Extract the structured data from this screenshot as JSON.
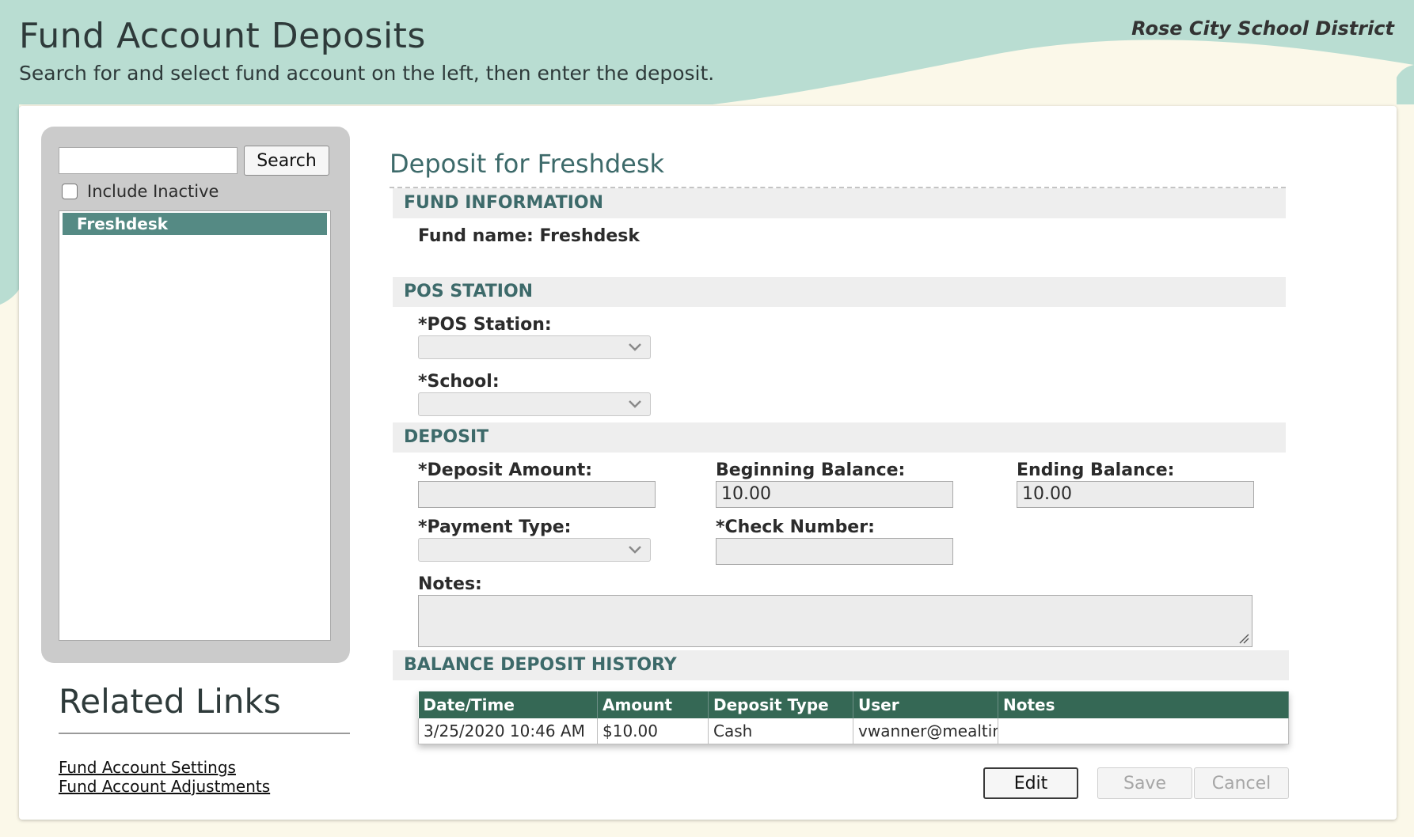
{
  "header": {
    "title": "Fund Account Deposits",
    "subtitle": "Search for and select fund account on the left, then enter the deposit.",
    "district": "Rose City School District"
  },
  "search": {
    "value": "",
    "button_label": "Search",
    "include_inactive_label": "Include Inactive",
    "include_inactive_checked": false,
    "results": [
      "Freshdesk"
    ],
    "selected": "Freshdesk"
  },
  "related_links": {
    "title": "Related Links",
    "links": [
      "Fund Account Settings",
      "Fund Account Adjustments"
    ]
  },
  "deposit": {
    "title": "Deposit for Freshdesk",
    "fund_info_header": "FUND INFORMATION",
    "fund_name_line": "Fund name: Freshdesk",
    "pos_header": "POS STATION",
    "pos_station_label": "*POS Station:",
    "pos_station_value": "",
    "school_label": "*School:",
    "school_value": "",
    "deposit_header": "DEPOSIT",
    "deposit_amount_label": "*Deposit Amount:",
    "deposit_amount_value": "",
    "beginning_balance_label": "Beginning Balance:",
    "beginning_balance_value": "10.00",
    "ending_balance_label": "Ending Balance:",
    "ending_balance_value": "10.00",
    "payment_type_label": "*Payment Type:",
    "payment_type_value": "",
    "check_number_label": "*Check Number:",
    "check_number_value": "",
    "notes_label": "Notes:",
    "notes_value": ""
  },
  "history": {
    "header": "BALANCE DEPOSIT HISTORY",
    "columns": [
      "Date/Time",
      "Amount",
      "Deposit Type",
      "User",
      "Notes"
    ],
    "rows": [
      [
        "3/25/2020 10:46 AM",
        "$10.00",
        "Cash",
        "vwanner@mealtim",
        ""
      ]
    ]
  },
  "actions": {
    "edit_label": "Edit",
    "save_label": "Save",
    "cancel_label": "Cancel"
  },
  "colors": {
    "header_wave": "#b9ddd2",
    "cream_wave": "#fbf8e9",
    "selected_item": "#558a84",
    "section_text": "#3d6a6a",
    "table_header": "#356855"
  }
}
